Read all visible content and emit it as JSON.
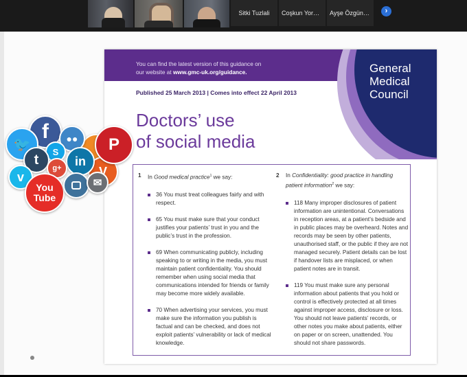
{
  "participants": [
    {
      "kind": "video"
    },
    {
      "kind": "video"
    },
    {
      "kind": "video"
    },
    {
      "kind": "name",
      "name": "Sitki Tuzlali"
    },
    {
      "kind": "name",
      "name": "Coşkun Yorul..."
    },
    {
      "kind": "name",
      "name": "Ayşe Özgün Ş..."
    }
  ],
  "next_icon": "›",
  "document": {
    "band_line1": "You can find the latest version of this guidance on",
    "band_line2_prefix": "our website at ",
    "band_url": "www.gmc-uk.org/guidance.",
    "org_name": [
      "General",
      "Medical",
      "Council"
    ],
    "published": "Published 25 March 2013 | Comes into effect 22 April 2013",
    "title_line1": "Doctors’ use",
    "title_line2": "of social media",
    "left": {
      "num": "1",
      "head_pre": "In ",
      "head_italic": "Good medical practice",
      "head_sup": "1",
      "head_post": " we say:",
      "items": [
        "36  You must treat colleagues fairly and with respect.",
        "65  You must make sure that your conduct justifies your patients’ trust in you and the public’s trust in the profession.",
        "69  When communicating publicly, including speaking to or writing in the media, you must maintain patient confidentiality. You should remember when using social media that communications intended for friends or family may become more widely available.",
        "70  When advertising your services, you must make sure the information you publish is factual and can be checked, and does not exploit patients’ vulnerability or lack of medical knowledge."
      ]
    },
    "right": {
      "num": "2",
      "head_pre": "In ",
      "head_italic": "Confidentiality: good practice in handling patient information",
      "head_sup": "2",
      "head_post": " we say:",
      "items": [
        "118  Many improper disclosures of patient information are unintentional. Conversations in reception areas, at a patient’s bedside and in public places may be overheard. Notes and records may be seen by other patients, unauthorised staff, or the public if they are not managed securely. Patient details can be lost if handover lists are misplaced, or when patient notes are in transit.",
        "119  You must make sure any personal information about patients that you hold or control is effectively protected at all times against improper access, disclosure or loss. You should not leave patients’ records, or other notes you make about patients, either on paper or on screen, unattended. You should not share passwords."
      ]
    }
  },
  "social_icons": {
    "facebook": "f",
    "pinterest": "P",
    "tumblr": "t",
    "linkedin": "in",
    "googleplus": "g+",
    "skype": "S",
    "vimeo": "v",
    "vine": "V",
    "youtube_you": "You",
    "youtube_tube": "Tube",
    "twitter": "🐦",
    "mail": "✉"
  },
  "colors": {
    "gmc_purple": "#5c2d8c",
    "gmc_navy": "#1e2a6e",
    "title_purple": "#6b3a9b"
  }
}
